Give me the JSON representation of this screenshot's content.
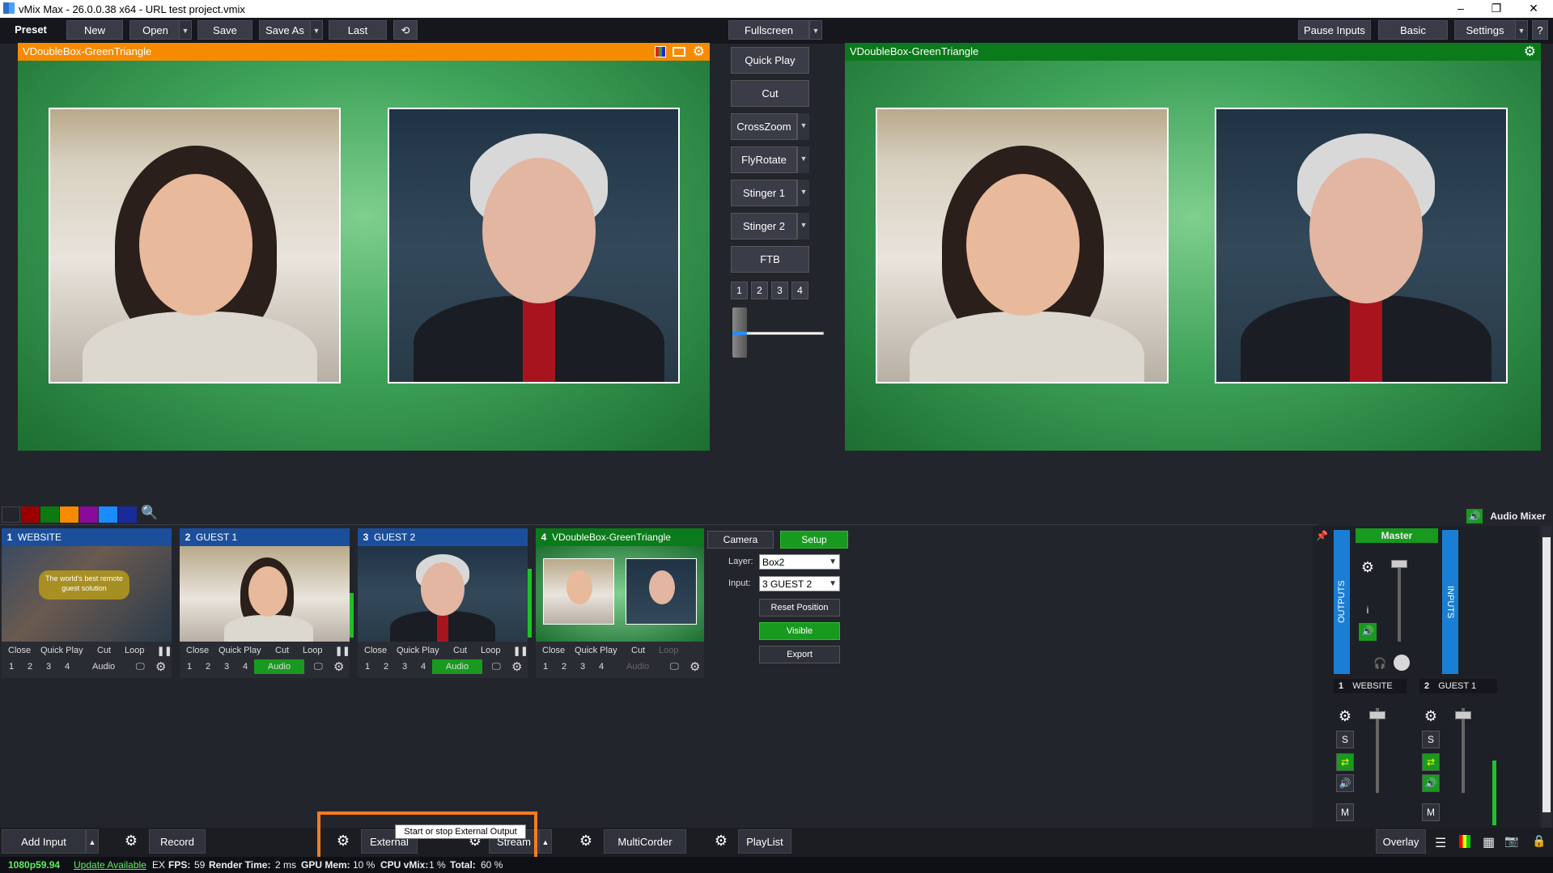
{
  "window": {
    "title": "vMix Max - 26.0.0.38 x64 - URL test project.vmix",
    "minimize": "–",
    "maximize": "❐",
    "close": "✕"
  },
  "menu": {
    "preset": "Preset",
    "new": "New",
    "open": "Open",
    "save": "Save",
    "save_as": "Save As",
    "last": "Last",
    "fullscreen": "Fullscreen",
    "pause_inputs": "Pause Inputs",
    "basic": "Basic",
    "settings": "Settings",
    "help": "?"
  },
  "preview": {
    "title": "VDoubleBox-GreenTriangle"
  },
  "output": {
    "title": "VDoubleBox-GreenTriangle"
  },
  "transitions": {
    "quick_play": "Quick Play",
    "cut": "Cut",
    "crosszoom": "CrossZoom",
    "flyrotate": "FlyRotate",
    "stinger1": "Stinger 1",
    "stinger2": "Stinger 2",
    "ftb": "FTB",
    "numbers": [
      "1",
      "2",
      "3",
      "4"
    ]
  },
  "colors": {
    "accent_orange": "#f78b00",
    "preview_bar": "#f78b00",
    "output_bar": "#0a7a1a",
    "input_header": "#1b4f9c",
    "active_green": "#189a1f"
  },
  "swatches": [
    "#23252d",
    "#9b0000",
    "#0c7a10",
    "#f78b00",
    "#8a0a9a",
    "#1a8cff",
    "#1a2a9a"
  ],
  "inputs": [
    {
      "num": "1",
      "name": "WEBSITE",
      "thumb_text": "The world's best remote guest solution",
      "r1": [
        "Close",
        "Quick Play",
        "Cut",
        "Loop"
      ],
      "r2": [
        "1",
        "2",
        "3",
        "4"
      ],
      "audio": "Audio",
      "audio_active": false
    },
    {
      "num": "2",
      "name": "GUEST 1",
      "r1": [
        "Close",
        "Quick Play",
        "Cut",
        "Loop"
      ],
      "r2": [
        "1",
        "2",
        "3",
        "4"
      ],
      "audio": "Audio",
      "audio_active": true
    },
    {
      "num": "3",
      "name": "GUEST 2",
      "r1": [
        "Close",
        "Quick Play",
        "Cut",
        "Loop"
      ],
      "r2": [
        "1",
        "2",
        "3",
        "4"
      ],
      "audio": "Audio",
      "audio_active": true
    },
    {
      "num": "4",
      "name": "VDoubleBox-GreenTriangle",
      "r1": [
        "Close",
        "Quick Play",
        "Cut",
        "Loop"
      ],
      "r2": [
        "1",
        "2",
        "3",
        "4"
      ],
      "audio": "Audio",
      "audio_active": false
    }
  ],
  "layer_panel": {
    "camera": "Camera",
    "setup": "Setup",
    "layer_label": "Layer:",
    "layer_value": "Box2",
    "input_label": "Input:",
    "input_value": "3 GUEST 2",
    "reset_position": "Reset Position",
    "visible": "Visible",
    "export": "Export"
  },
  "audio_mixer": {
    "title": "Audio Mixer",
    "master": "Master",
    "outputs": "OUTPUTS",
    "inputs": "INPUTS",
    "info": "i",
    "s": "S",
    "m": "M",
    "channels": [
      {
        "num": "1",
        "name": "WEBSITE"
      },
      {
        "num": "2",
        "name": "GUEST 1"
      }
    ]
  },
  "bottom": {
    "add_input": "Add Input",
    "record": "Record",
    "external": "External",
    "stream": "Stream",
    "multicorder": "MultiCorder",
    "playlist": "PlayList",
    "overlay": "Overlay",
    "tooltip": "Start or stop External Output"
  },
  "status": {
    "format": "1080p59.94",
    "update": "Update Available",
    "ex": "EX",
    "fps_label": "FPS:",
    "fps": "59",
    "render_label": "Render Time:",
    "render": "2 ms",
    "gpu_label": "GPU Mem:",
    "gpu": "10 %",
    "cpu_label": "CPU vMix:",
    "cpu": "1 %",
    "total_label": "Total:",
    "total": "60 %"
  }
}
